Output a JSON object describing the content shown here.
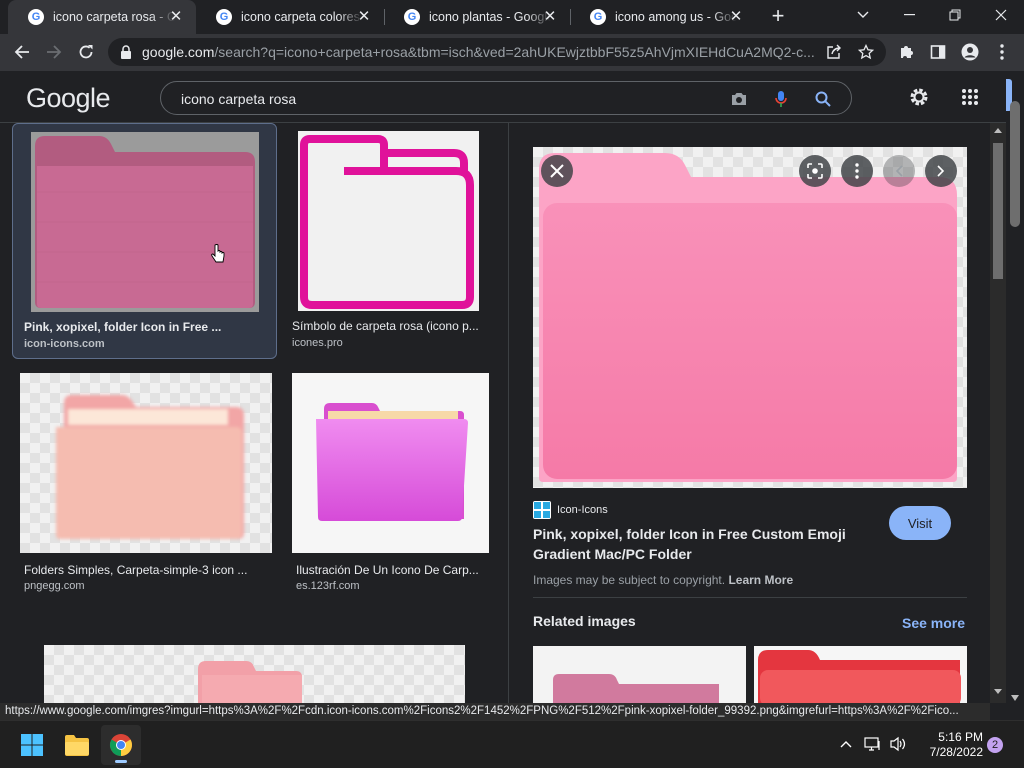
{
  "tabs": [
    {
      "title": "icono carpeta rosa - Google",
      "active": true
    },
    {
      "title": "icono carpeta colores - Google",
      "active": false
    },
    {
      "title": "icono plantas - Google Search",
      "active": false
    },
    {
      "title": "icono among us - Google",
      "active": false
    }
  ],
  "address_bar": {
    "host": "google.com",
    "path": "/search?q=icono+carpeta+rosa&tbm=isch&ved=2ahUKEwjztbbF55z5AhVjmXIEHdCuA2MQ2-c..."
  },
  "google": {
    "logo": "Google",
    "query": "icono carpeta rosa"
  },
  "results": [
    {
      "title": "Pink, xopixel, folder Icon in Free ...",
      "source": "icon-icons.com",
      "selected": true
    },
    {
      "title": "Símbolo de carpeta rosa (icono p...",
      "source": "icones.pro",
      "selected": false
    },
    {
      "title": "Folders Simples, Carpeta-simple-3 icon ...",
      "source": "pngegg.com",
      "selected": false
    },
    {
      "title": "Ilustración De Un Icono De Carp...",
      "source": "es.123rf.com",
      "selected": false
    }
  ],
  "panel": {
    "site_name": "Icon-Icons",
    "title": "Pink, xopixel, folder Icon in Free Custom Emoji Gradient Mac/PC Folder",
    "visit_label": "Visit",
    "copyright_text": "Images may be subject to copyright.",
    "learn_more": "Learn More",
    "related_heading": "Related images",
    "see_more": "See more"
  },
  "status_url": "https://www.google.com/imgres?imgurl=https%3A%2F%2Fcdn.icon-icons.com%2Ficons2%2F1452%2FPNG%2F512%2Fpink-xopixel-folder_99392.png&imgrefurl=https%3A%2F%2Fico...",
  "taskbar": {
    "time": "5:16 PM",
    "date": "7/28/2022",
    "notification_count": "2"
  },
  "colors": {
    "background": "#202124",
    "accent": "#8ab4f8",
    "folder_pink": "#f78fb3",
    "folder_magenta": "#e0129a",
    "taskbar": "#202020"
  },
  "icons": [
    "google-favicon",
    "close-icon",
    "new-tab-icon",
    "chevron-down-icon",
    "minimize-icon",
    "restore-icon",
    "back-icon",
    "forward-icon",
    "reload-icon",
    "lock-icon",
    "share-icon",
    "star-icon",
    "extensions-icon",
    "side-panel-icon",
    "profile-icon",
    "menu-icon",
    "camera-icon",
    "mic-icon",
    "search-icon",
    "settings-icon",
    "apps-grid-icon",
    "lens-icon",
    "more-icon",
    "windows-start-icon",
    "file-explorer-icon",
    "chrome-icon",
    "wifi-icon",
    "volume-icon"
  ]
}
